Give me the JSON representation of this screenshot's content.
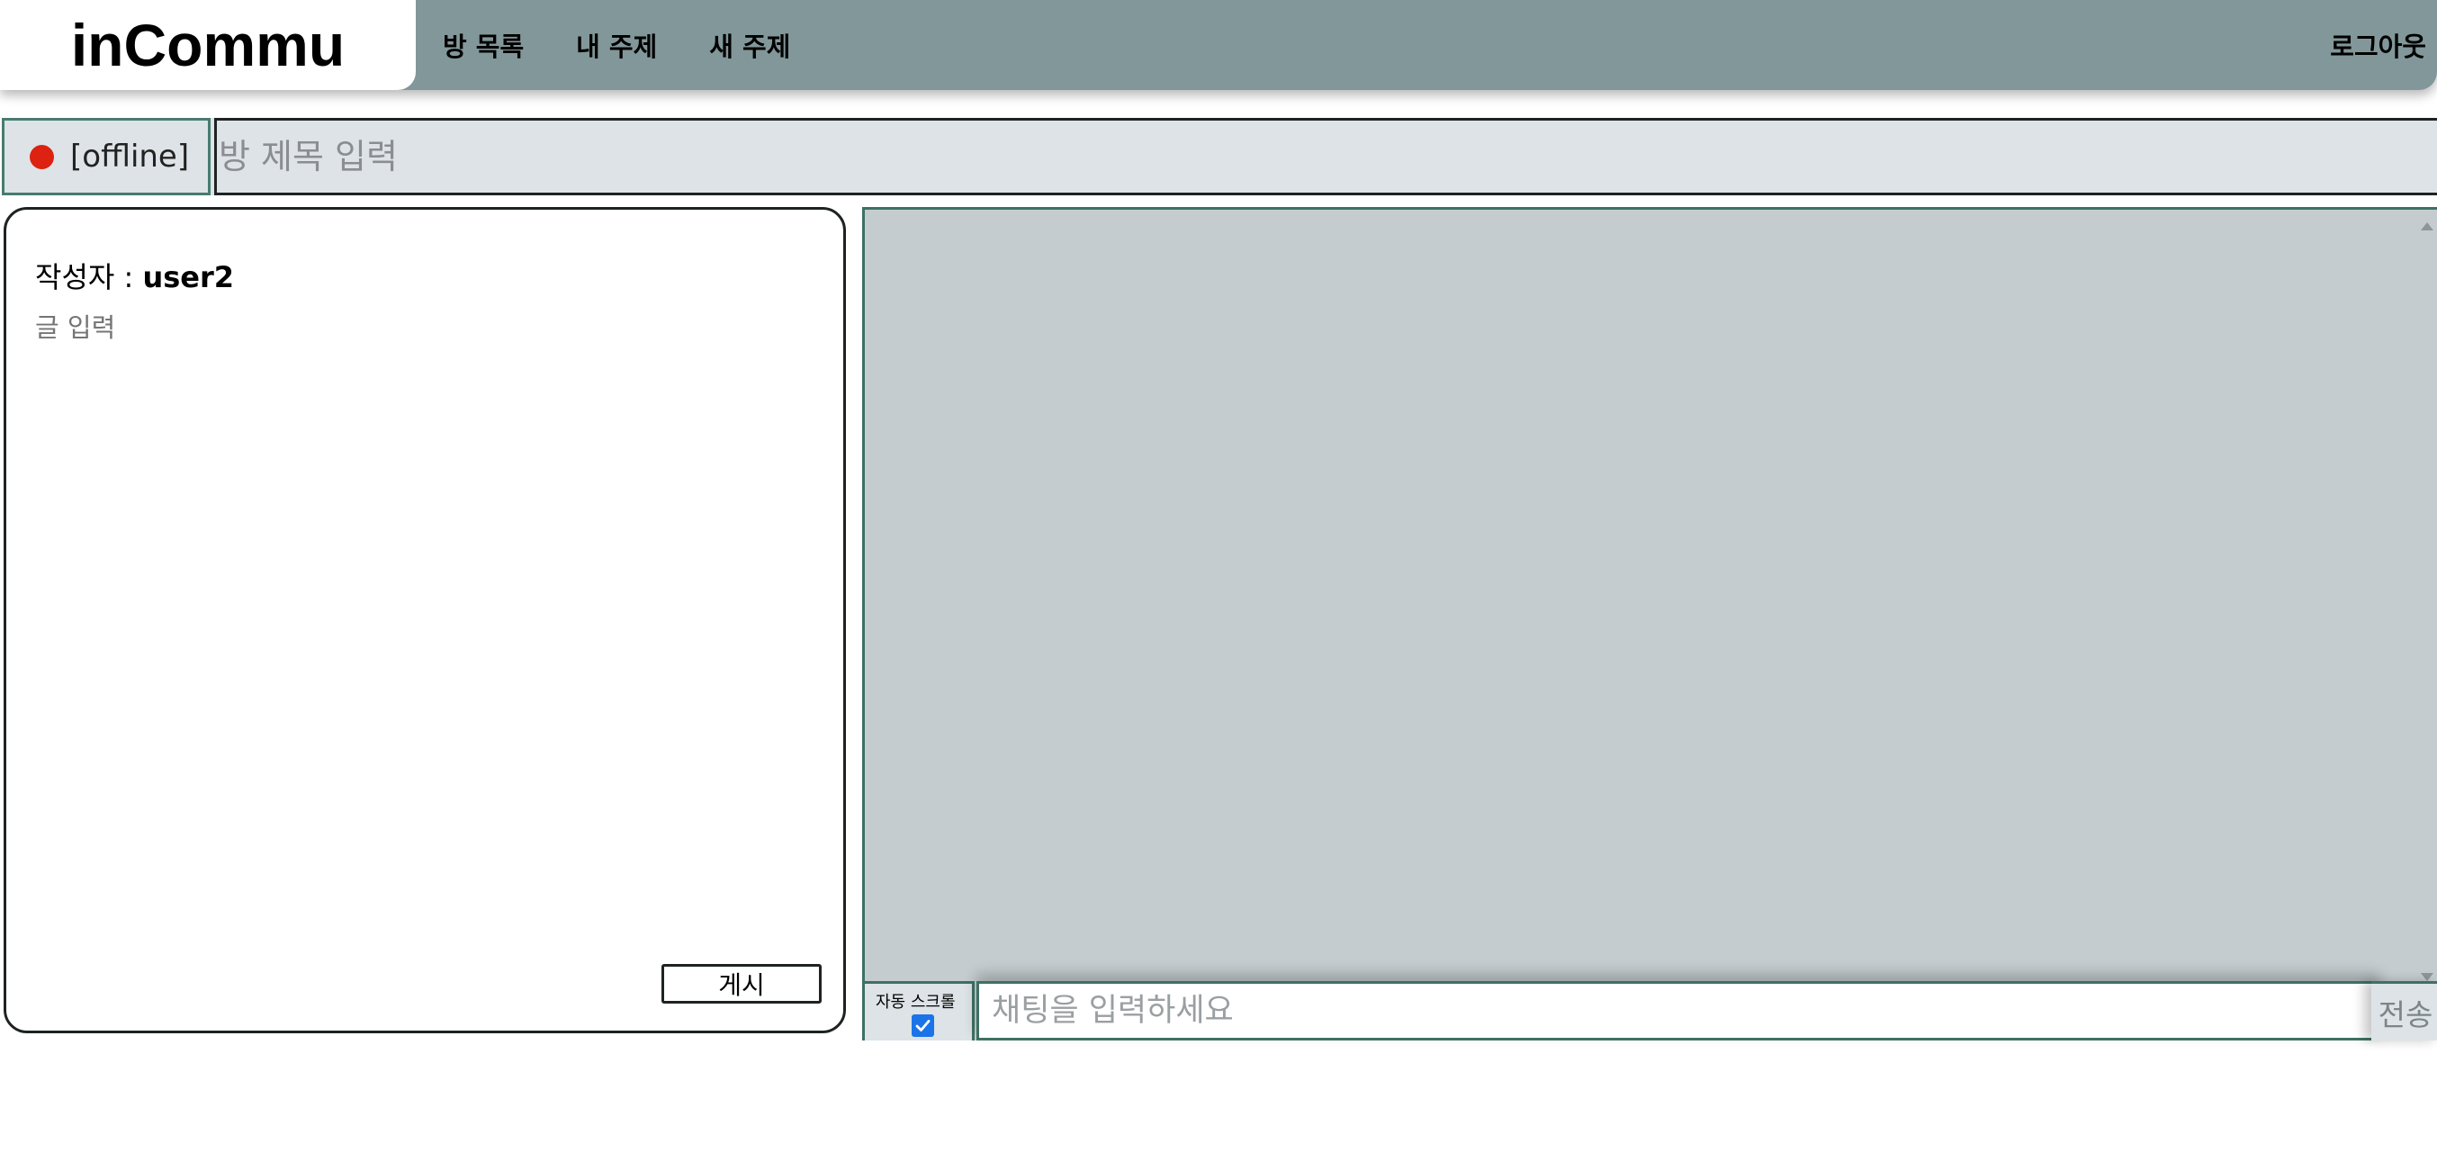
{
  "header": {
    "logo": "inCommu",
    "nav": [
      {
        "label": "방 목록"
      },
      {
        "label": "내 주제"
      },
      {
        "label": "새 주제"
      }
    ],
    "logout_label": "로그아웃"
  },
  "room": {
    "status_text": "[offline]",
    "status_color": "#dd2211",
    "title_placeholder": "방 제목 입력",
    "title_value": ""
  },
  "post": {
    "author_label": "작성자 : ",
    "author_name": "user2",
    "text_placeholder": "글 입력",
    "submit_label": "게시"
  },
  "chat": {
    "autoscroll_label": "자동 스크롤",
    "autoscroll_checked": true,
    "input_placeholder": "채팅을 입력하세요",
    "send_label": "전송"
  },
  "colors": {
    "header_bg": "#82979a",
    "accent_border": "#477c70",
    "chat_bg": "#c4cccf",
    "bar_bg": "#dde3e6"
  }
}
